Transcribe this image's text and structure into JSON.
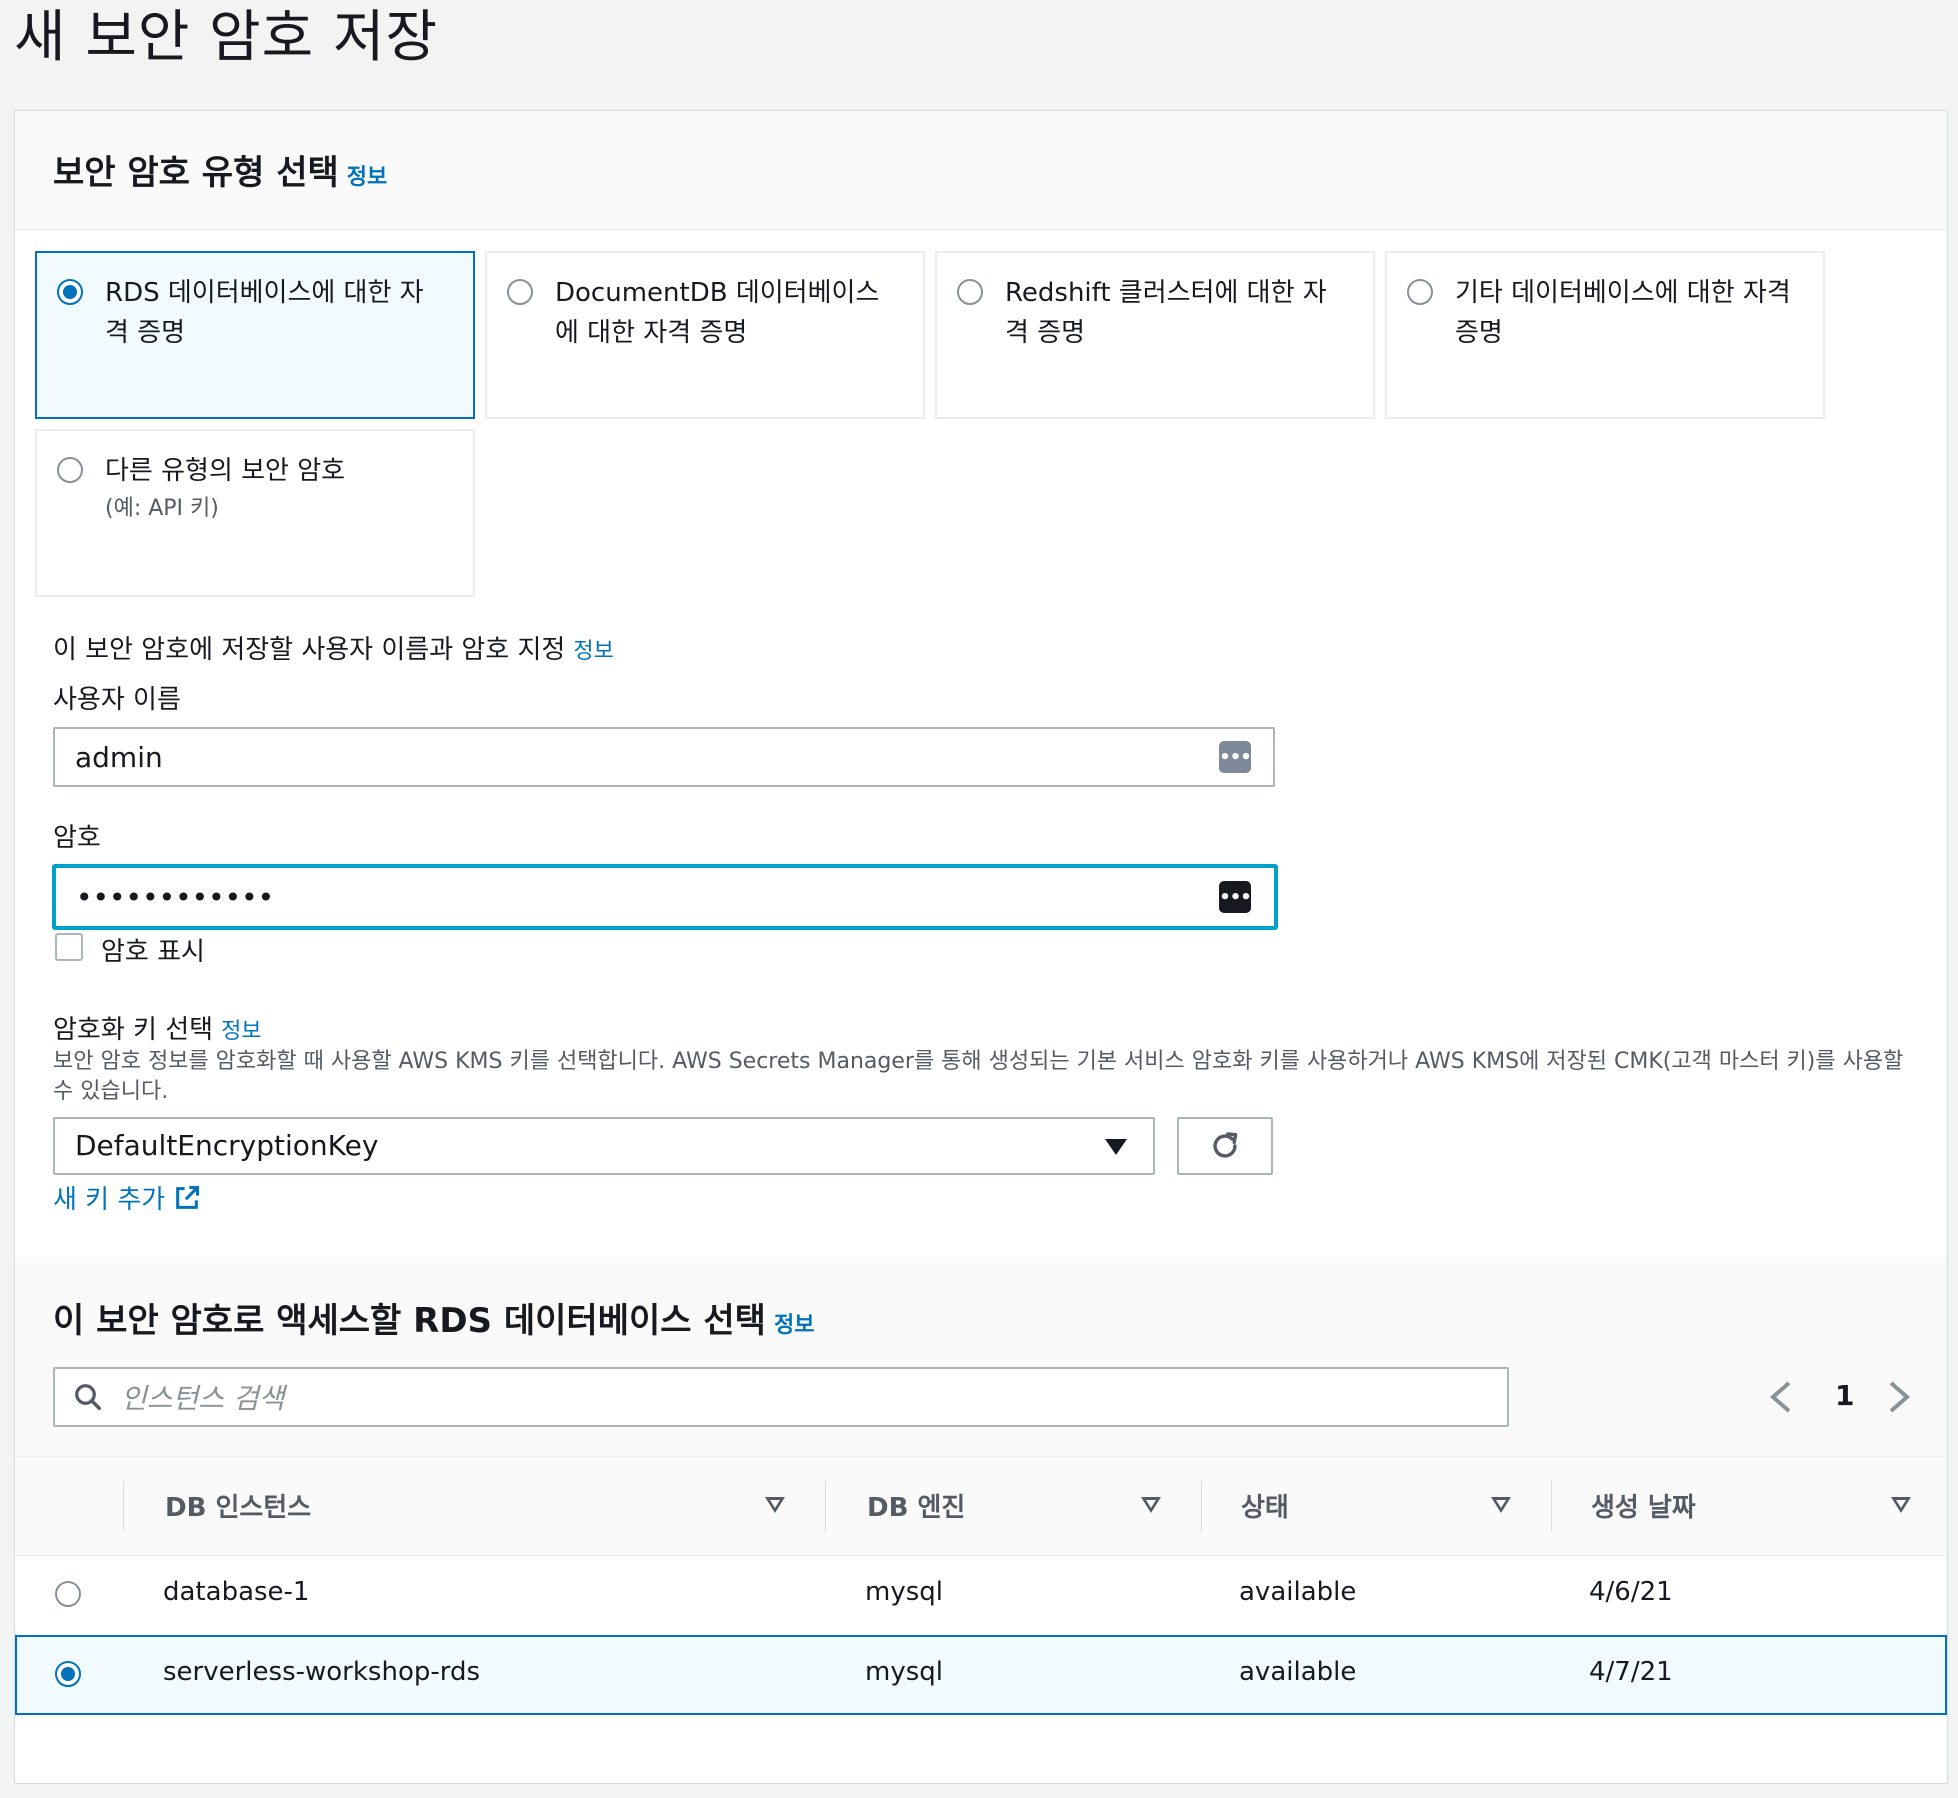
{
  "page": {
    "title": "새 보안 암호 저장"
  },
  "colors": {
    "accent": "#0073bb",
    "focus": "#00a1c9",
    "text": "#16191f"
  },
  "secret_type": {
    "heading": "보안 암호 유형 선택",
    "info": "정보",
    "options": [
      {
        "label": "RDS 데이터베이스에 대한 자격 증명",
        "desc": "",
        "selected": true
      },
      {
        "label": "DocumentDB 데이터베이스에 대한 자격 증명",
        "desc": "",
        "selected": false
      },
      {
        "label": "Redshift 클러스터에 대한 자격 증명",
        "desc": "",
        "selected": false
      },
      {
        "label": "기타 데이터베이스에 대한 자격 증명",
        "desc": "",
        "selected": false
      },
      {
        "label": "다른 유형의 보안 암호",
        "desc": "(예: API 키)",
        "selected": false
      }
    ]
  },
  "credentials": {
    "heading": "이 보안 암호에 저장할 사용자 이름과 암호 지정",
    "info": "정보",
    "username_label": "사용자 이름",
    "username_value": "admin",
    "password_label": "암호",
    "password_value": "••••••••••••",
    "show_password_label": "암호 표시",
    "icon": "password-manager-icon"
  },
  "encryption": {
    "label": "암호화 키 선택",
    "info": "정보",
    "description": "보안 암호 정보를 암호화할 때 사용할 AWS KMS 키를 선택합니다. AWS Secrets Manager를 통해 생성되는 기본 서비스 암호화 키를 사용하거나 AWS KMS에 저장된 CMK(고객 마스터 키)를 사용할 수 있습니다.",
    "selected_key": "DefaultEncryptionKey",
    "add_key_link": "새 키 추가"
  },
  "database_select": {
    "heading": "이 보안 암호로 액세스할 RDS 데이터베이스 선택",
    "info": "정보",
    "search_placeholder": "인스턴스 검색",
    "page": "1",
    "columns": [
      "DB 인스턴스",
      "DB 엔진",
      "상태",
      "생성 날짜"
    ],
    "rows": [
      {
        "instance": "database-1",
        "engine": "mysql",
        "status": "available",
        "created": "4/6/21",
        "selected": false
      },
      {
        "instance": "serverless-workshop-rds",
        "engine": "mysql",
        "status": "available",
        "created": "4/7/21",
        "selected": true
      }
    ]
  }
}
